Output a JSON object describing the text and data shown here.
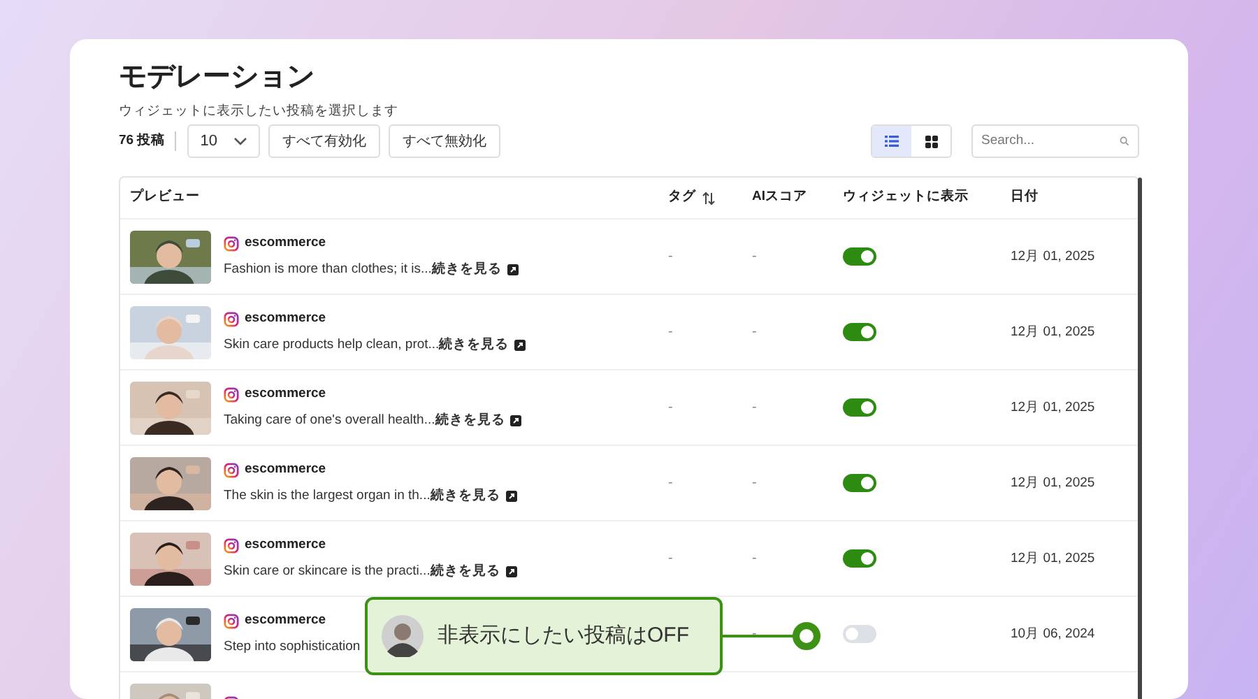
{
  "title": "モデレーション",
  "subtitle": "ウィジェットに表示したい投稿を選択します",
  "toolbar": {
    "count": "76 投稿",
    "page_size": "10",
    "enable_all": "すべて有効化",
    "disable_all": "すべて無効化",
    "views": [
      {
        "kind": "list",
        "selected": true
      },
      {
        "kind": "grid",
        "selected": false
      }
    ],
    "search": {
      "placeholder": "Search..."
    }
  },
  "table": {
    "columns": [
      {
        "label": "プレビュー"
      },
      {
        "label": "タグ",
        "sortable": true
      },
      {
        "label": "AIスコア"
      },
      {
        "label": "ウィジェットに表示"
      },
      {
        "label": "日付"
      }
    ],
    "rows": [
      {
        "account": "escommerce",
        "caption": "Fashion is more than clothes; it is...",
        "more": "続きを見る",
        "tag": "-",
        "ai_score": "-",
        "shown": true,
        "date": "12月 01, 2025"
      },
      {
        "account": "escommerce",
        "caption": "Skin care products help clean, prot...",
        "more": "続きを見る",
        "tag": "-",
        "ai_score": "-",
        "shown": true,
        "date": "12月 01, 2025"
      },
      {
        "account": "escommerce",
        "caption": "Taking care of one's overall health...",
        "more": "続きを見る",
        "tag": "-",
        "ai_score": "-",
        "shown": true,
        "date": "12月 01, 2025"
      },
      {
        "account": "escommerce",
        "caption": "The skin is the largest organ in th...",
        "more": "続きを見る",
        "tag": "-",
        "ai_score": "-",
        "shown": true,
        "date": "12月 01, 2025"
      },
      {
        "account": "escommerce",
        "caption": "Skin care or skincare is the practi...",
        "more": "続きを見る",
        "tag": "-",
        "ai_score": "-",
        "shown": true,
        "date": "12月 01, 2025"
      },
      {
        "account": "escommerce",
        "caption": "Step into sophistication",
        "ai_score": "-",
        "shown": false,
        "date": "10月 06, 2024"
      },
      {
        "kind": "cut"
      }
    ]
  },
  "callout": {
    "text": "非表示にしたい投稿はOFF"
  }
}
